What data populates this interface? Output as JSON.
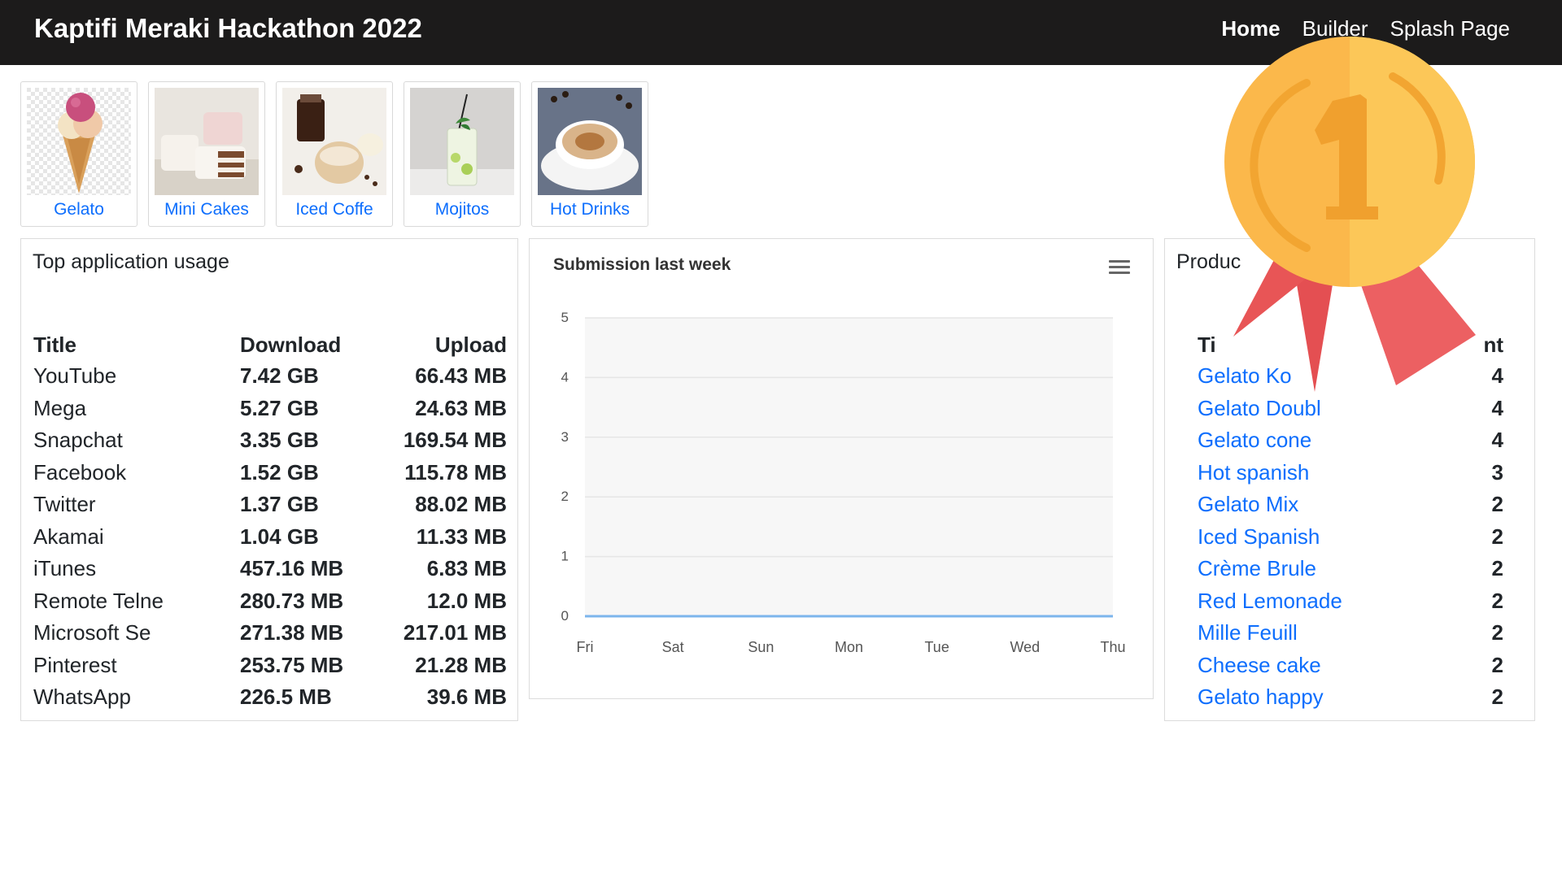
{
  "navbar": {
    "brand": "Kaptifi Meraki Hackathon 2022",
    "links": [
      "Home",
      "Builder",
      "Splash Page"
    ]
  },
  "categories": [
    {
      "label": "Gelato",
      "image": "gelato-cone-image"
    },
    {
      "label": "Mini Cakes",
      "image": "mini-cakes-image"
    },
    {
      "label": "Iced Coffe",
      "image": "iced-coffee-image"
    },
    {
      "label": "Mojitos",
      "image": "mojito-image"
    },
    {
      "label": "Hot Drinks",
      "image": "cappuccino-image"
    }
  ],
  "usage": {
    "title": "Top application usage",
    "headers": [
      "Title",
      "Download",
      "Upload"
    ],
    "rows": [
      [
        "YouTube",
        "7.42 GB",
        "66.43 MB"
      ],
      [
        "Mega",
        "5.27 GB",
        "24.63 MB"
      ],
      [
        "Snapchat",
        "3.35 GB",
        "169.54 MB"
      ],
      [
        "Facebook",
        "1.52 GB",
        "115.78 MB"
      ],
      [
        "Twitter",
        "1.37 GB",
        "88.02 MB"
      ],
      [
        "Akamai",
        "1.04 GB",
        "11.33 MB"
      ],
      [
        "iTunes",
        "457.16 MB",
        "6.83 MB"
      ],
      [
        "Remote Telne",
        "280.73 MB",
        "12.0 MB"
      ],
      [
        "Microsoft Se",
        "271.38 MB",
        "217.01 MB"
      ],
      [
        "Pinterest",
        "253.75 MB",
        "21.28 MB"
      ],
      [
        "WhatsApp",
        "226.5 MB",
        "39.6 MB"
      ]
    ]
  },
  "chart_data": {
    "type": "area",
    "title": "Submission last week",
    "categories": [
      "Fri",
      "Sat",
      "Sun",
      "Mon",
      "Tue",
      "Wed",
      "Thu"
    ],
    "series": [
      {
        "values": [
          0,
          0,
          0,
          0,
          0,
          0,
          0
        ]
      }
    ],
    "ylim": [
      0,
      5
    ],
    "yticks": [
      0,
      1,
      2,
      3,
      4,
      5
    ],
    "grid": true,
    "colors": {
      "series": "#7cb5ec",
      "band": "#f7f7f7",
      "grid": "#e6e6e6"
    }
  },
  "products": {
    "title": "Produc",
    "headers": [
      "Ti",
      "nt"
    ],
    "rows": [
      [
        "Gelato Ko",
        "4"
      ],
      [
        "Gelato Doubl",
        "4"
      ],
      [
        "Gelato cone",
        "4"
      ],
      [
        "Hot spanish",
        "3"
      ],
      [
        "Gelato Mix",
        "2"
      ],
      [
        "Iced Spanish",
        "2"
      ],
      [
        "Crème Brule",
        "2"
      ],
      [
        "Red Lemonade",
        "2"
      ],
      [
        "Mille Feuill",
        "2"
      ],
      [
        "Cheese cake",
        "2"
      ],
      [
        "Gelato happy",
        "2"
      ]
    ]
  },
  "medal": {
    "number": "1",
    "icon": "first-place-medal-icon"
  }
}
